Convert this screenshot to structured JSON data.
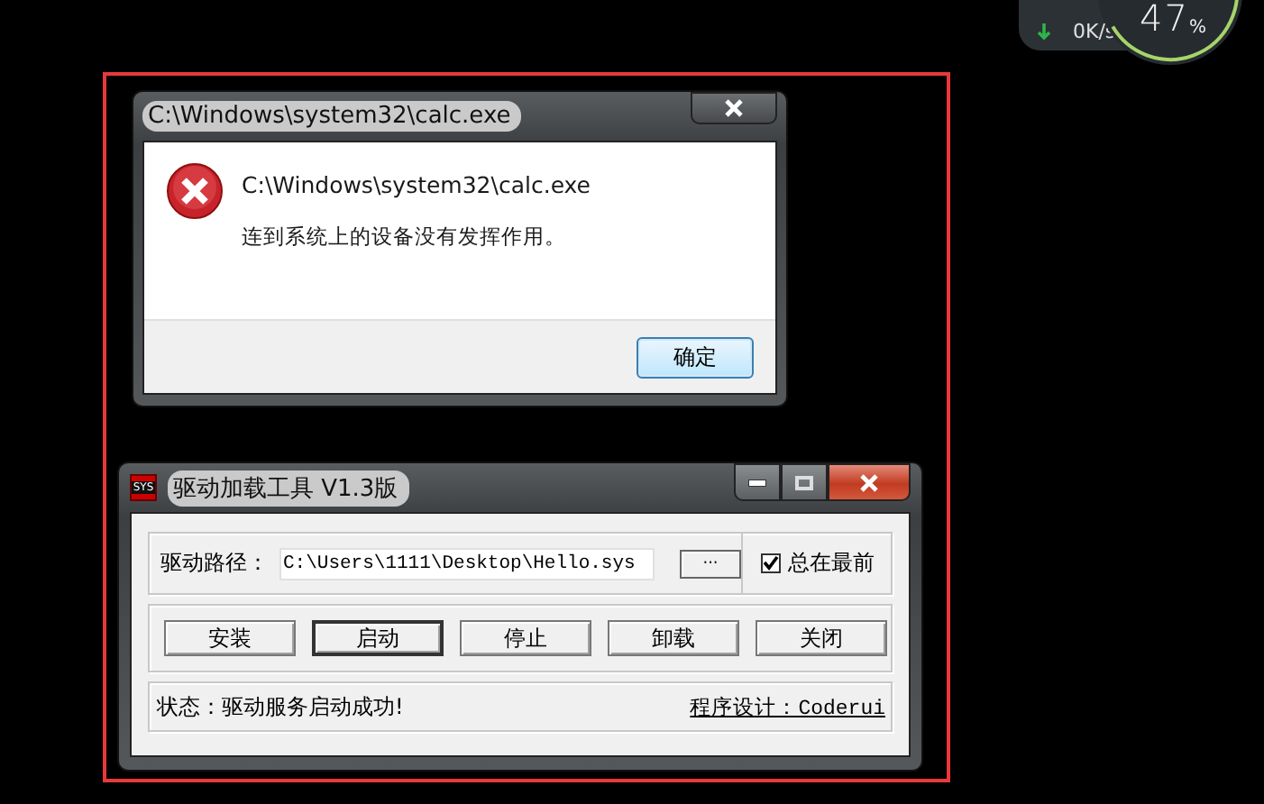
{
  "desktop_widget": {
    "download_speed": "0",
    "speed_unit": "K/s",
    "usage": "47",
    "usage_unit": "%",
    "level": 0.47
  },
  "error_dialog": {
    "title": "C:\\Windows\\system32\\calc.exe",
    "message_title": "C:\\Windows\\system32\\calc.exe",
    "message": "连到系统上的设备没有发挥作用。",
    "ok_button": "确定"
  },
  "loader_window": {
    "title": "驱动加载工具 V1.3版",
    "app_icon_label": "SYS",
    "path_label": "驱动路径：",
    "path_value": "C:\\Users\\1111\\Desktop\\Hello.sys",
    "browse_button": "···",
    "always_on_top": {
      "label": "总在最前",
      "checked": true
    },
    "buttons": [
      {
        "label": "安装",
        "focused": false
      },
      {
        "label": "启动",
        "focused": true
      },
      {
        "label": "停止",
        "focused": false
      },
      {
        "label": "卸载",
        "focused": false
      },
      {
        "label": "关闭",
        "focused": false
      }
    ],
    "status": "状态：驱动服务启动成功!",
    "credit": "程序设计：Coderui"
  }
}
